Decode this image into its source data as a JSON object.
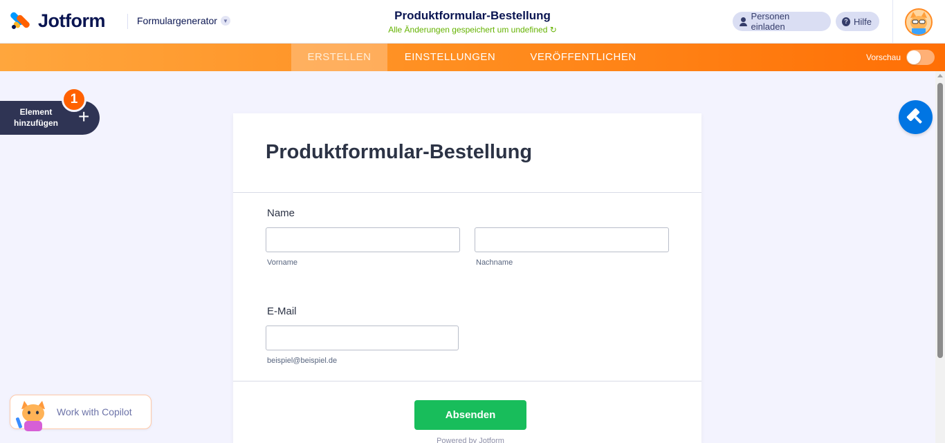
{
  "header": {
    "logo_text": "Jotform",
    "builder_menu_label": "Formulargenerator",
    "form_title": "Produktformular-Bestellung",
    "save_status": "Alle Änderungen gespeichert um undefined",
    "invite_label": "Personen einladen",
    "help_label": "Hilfe"
  },
  "nav": {
    "tabs": [
      {
        "label": "ERSTELLEN",
        "active": true
      },
      {
        "label": "EINSTELLUNGEN",
        "active": false
      },
      {
        "label": "VERÖFFENTLICHEN",
        "active": false
      }
    ],
    "preview_label": "Vorschau",
    "preview_enabled": false
  },
  "sidebar": {
    "add_element_label": "Element hinzufügen",
    "badge_count": "1"
  },
  "form": {
    "heading": "Produktformular-Bestellung",
    "name_label": "Name",
    "first_name_value": "",
    "last_name_value": "",
    "first_name_sublabel": "Vorname",
    "last_name_sublabel": "Nachname",
    "email_label": "E-Mail",
    "email_value": "",
    "email_sublabel": "beispiel@beispiel.de",
    "submit_label": "Absenden",
    "powered_by": "Powered by  Jotform"
  },
  "copilot": {
    "label": "Work with Copilot"
  },
  "colors": {
    "brand_orange": "#ff6100",
    "brand_navy": "#0a1551",
    "submit_green": "#18bd5b",
    "designer_blue": "#0075e3",
    "saved_green": "#64b200"
  },
  "icons": [
    "jotform-logo-icon",
    "chevron-down-icon",
    "refresh-icon",
    "person-icon",
    "help-icon",
    "user-avatar",
    "plus-icon",
    "paint-roller-icon",
    "copilot-mascot-icon"
  ]
}
